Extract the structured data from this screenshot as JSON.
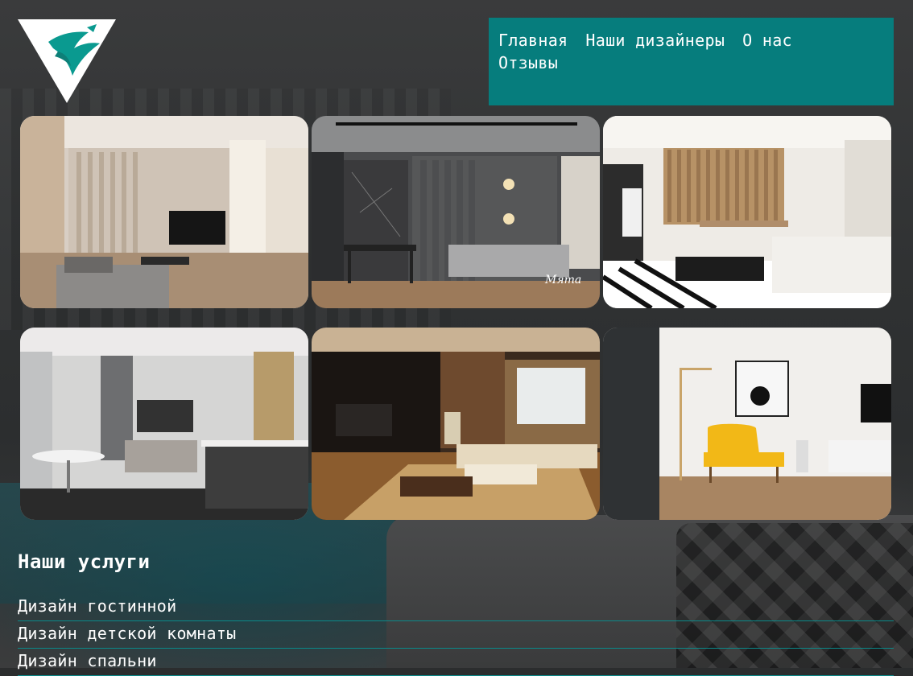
{
  "nav": {
    "items": [
      "Главная",
      "Наши дизайнеры",
      "О нас",
      "Отзывы"
    ]
  },
  "gallery": {
    "photos": [
      "living-room-beige-tv",
      "living-room-dark-grey",
      "living-dining-white",
      "living-kitchen-grey",
      "living-room-warm-lights",
      "room-yellow-armchair"
    ]
  },
  "services": {
    "title": "Наши услуги",
    "items": [
      "Дизайн гостинной",
      "Дизайн детской комнаты",
      "Дизайн спальни"
    ]
  },
  "watermark": "Мята",
  "colors": {
    "accent": "#067d7d",
    "text": "#ffffff"
  }
}
